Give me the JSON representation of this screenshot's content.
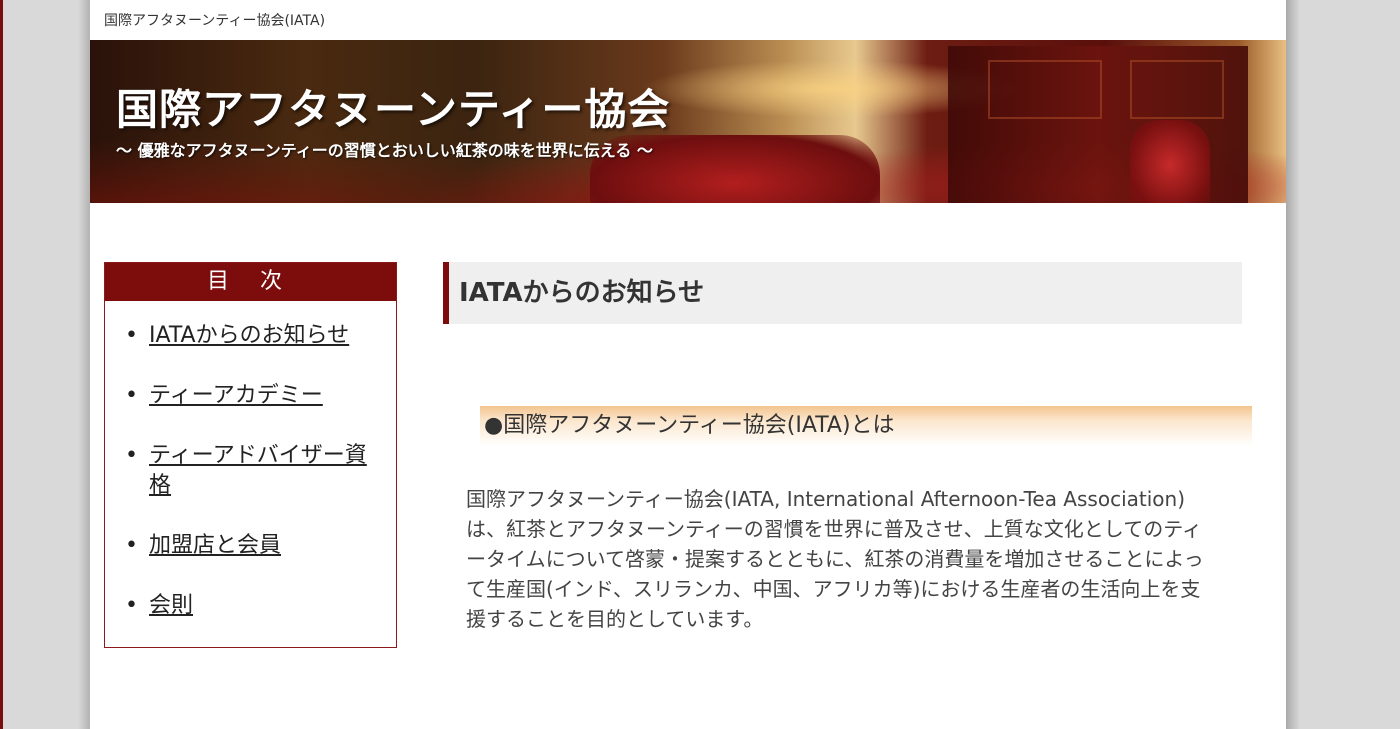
{
  "site": {
    "name": "国際アフタヌーンティー協会(IATA)"
  },
  "banner": {
    "title": "国際アフタヌーンティー協会",
    "tagline": "～ 優雅なアフタヌーンティーの習慣とおいしい紅茶の味を世界に伝える ～"
  },
  "sidebar": {
    "heading": "目 次",
    "items": [
      {
        "label": "IATAからのお知らせ"
      },
      {
        "label": "ティーアカデミー"
      },
      {
        "label": "ティーアドバイザー資格"
      },
      {
        "label": "加盟店と会員"
      },
      {
        "label": "会則"
      }
    ]
  },
  "main": {
    "title": "IATAからのお知らせ",
    "section_heading": "●国際アフタヌーンティー協会(IATA)とは",
    "section_body": "国際アフタヌーンティー協会(IATA, International Afternoon-Tea Association)は、紅茶とアフタヌーンティーの習慣を世界に普及させ、上質な文化としてのティータイムについて啓蒙・提案するとともに、紅茶の消費量を増加させることによって生産国(インド、スリランカ、中国、アフリカ等)における生産者の生活向上を支援することを目的としています。"
  },
  "colors": {
    "accent": "#7d0c0c",
    "title_bg": "#efefef",
    "section_gradient_top": "#f3c48e"
  }
}
